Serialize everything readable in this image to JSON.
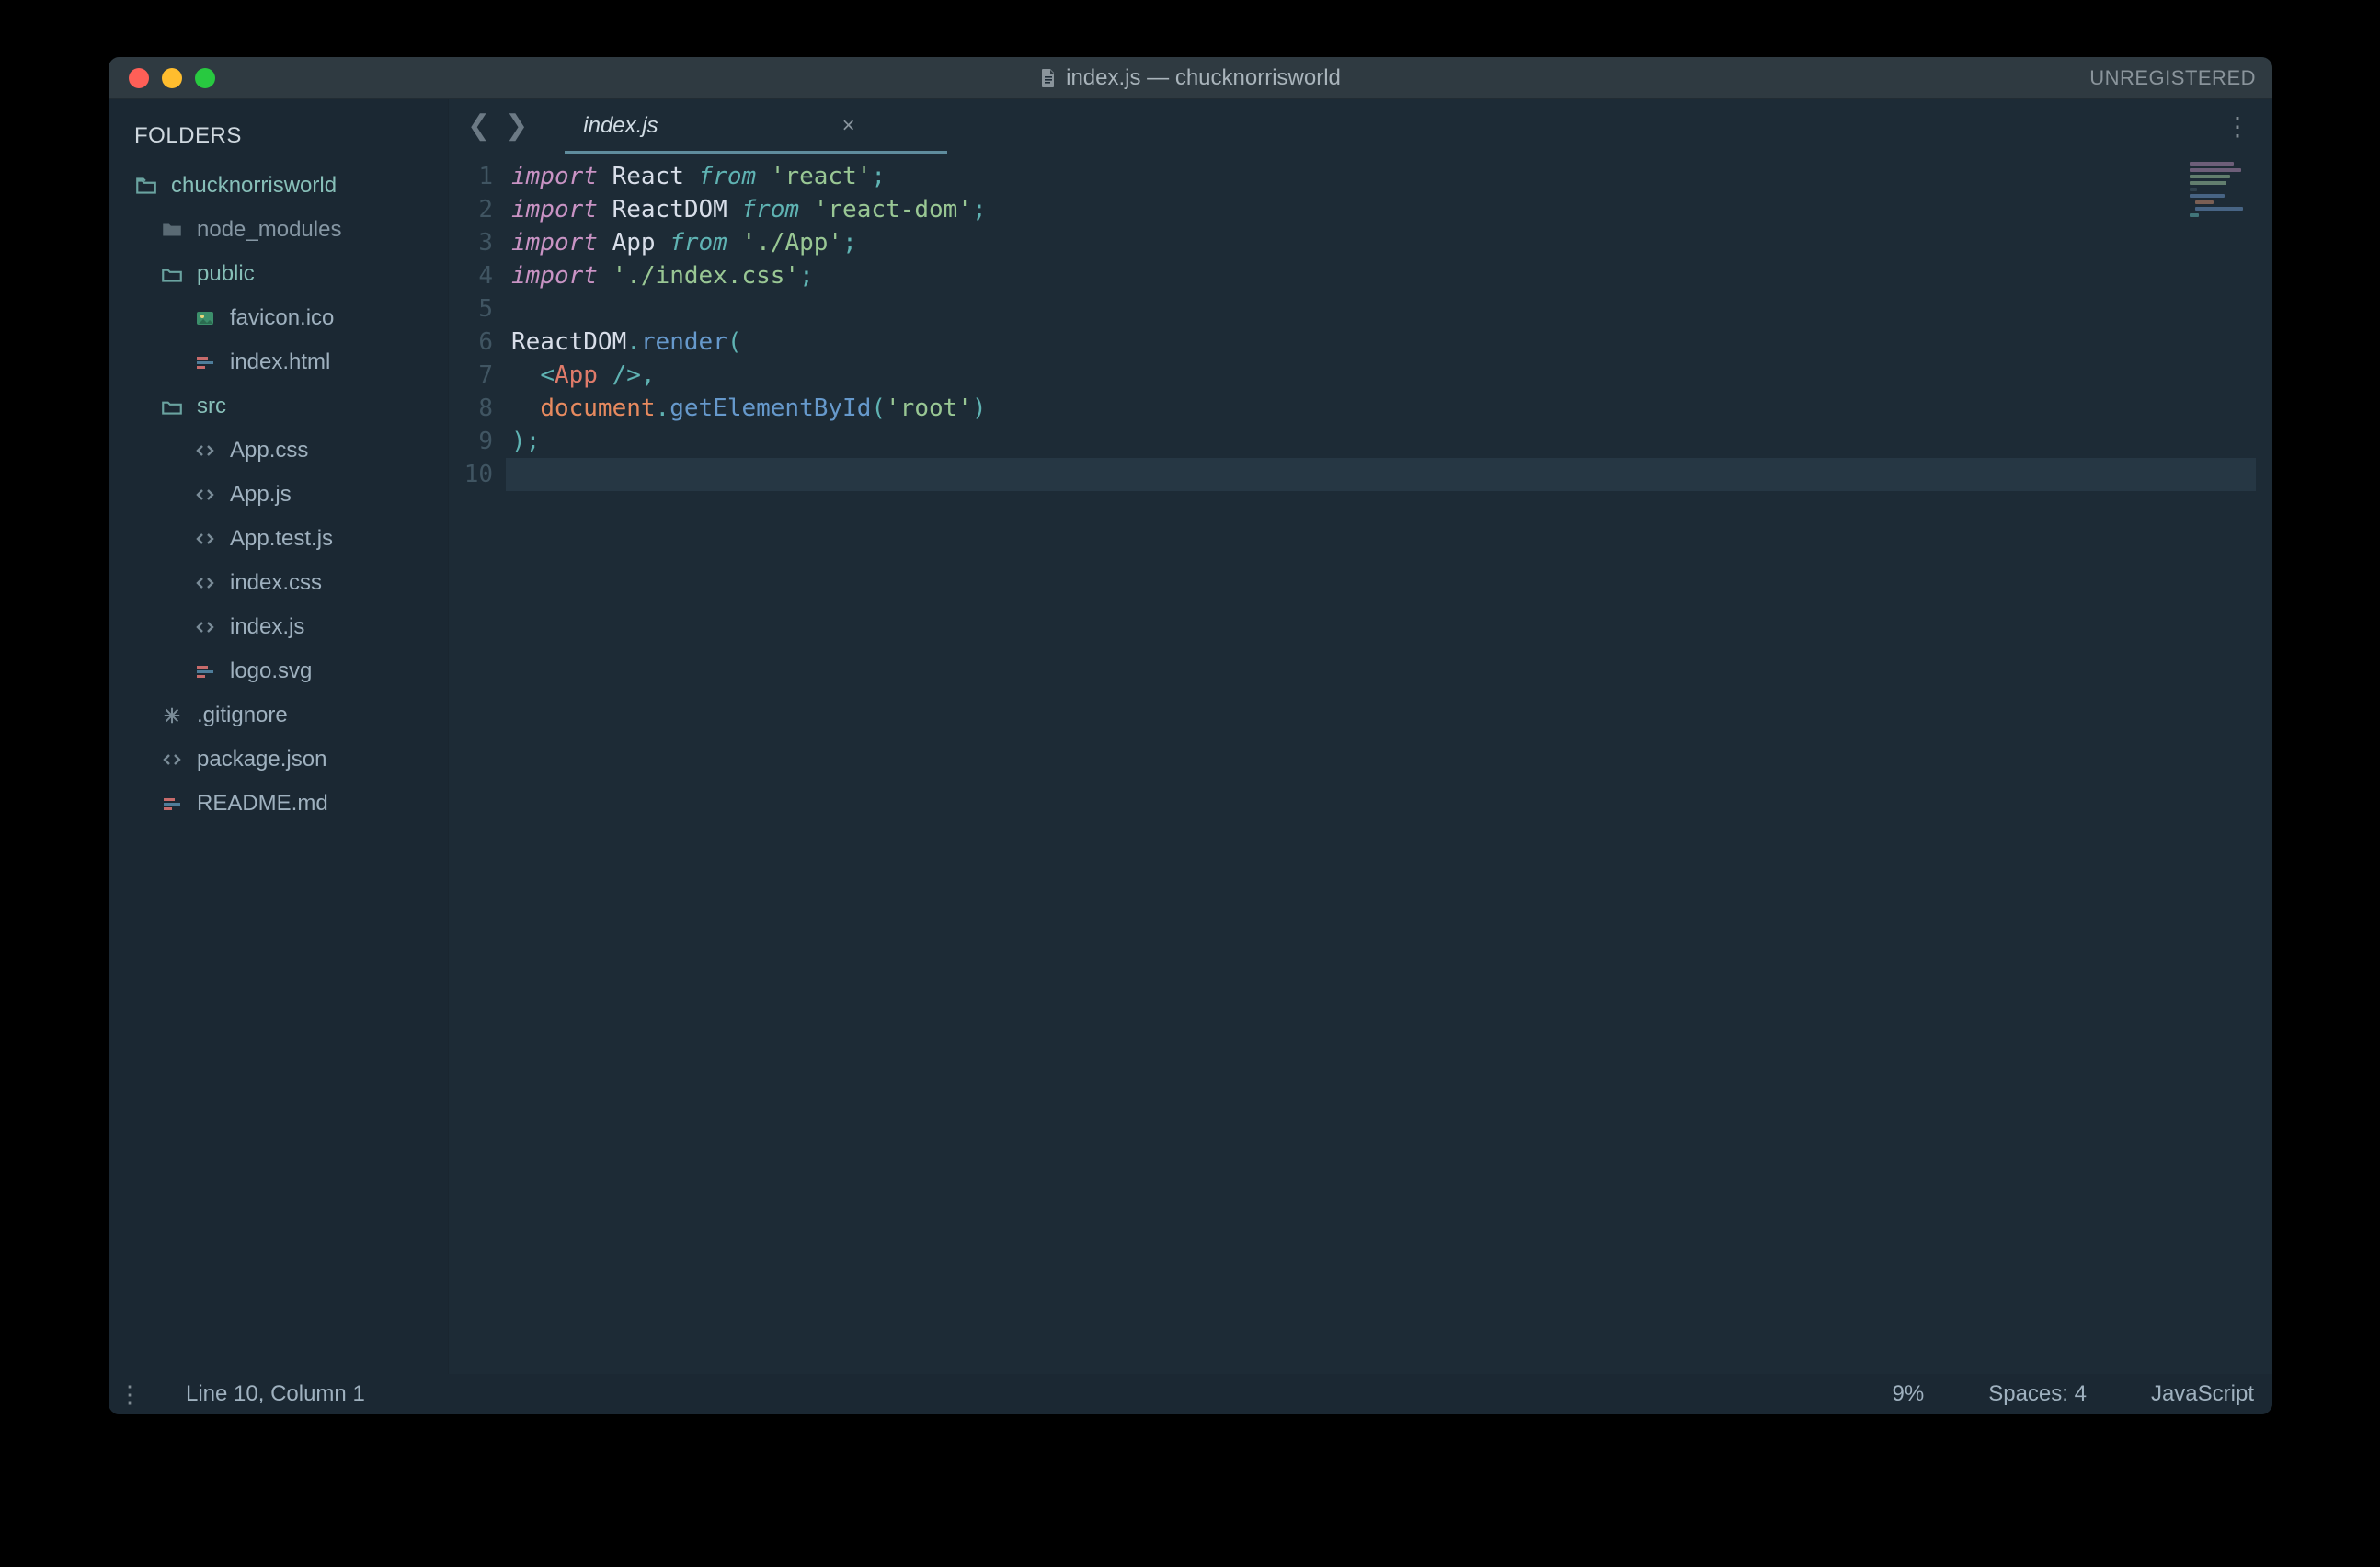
{
  "titlebar": {
    "title": "index.js — chucknorrisworld",
    "unregistered": "UNREGISTERED"
  },
  "sidebar": {
    "header": "FOLDERS",
    "tree": {
      "root": "chucknorrisworld",
      "node_modules": "node_modules",
      "public": "public",
      "public_items": {
        "favicon": "favicon.ico",
        "indexhtml": "index.html"
      },
      "src": "src",
      "src_items": {
        "appcss": "App.css",
        "appjs": "App.js",
        "apptest": "App.test.js",
        "indexcss": "index.css",
        "indexjs": "index.js",
        "logosvg": "logo.svg"
      },
      "gitignore": ".gitignore",
      "packagejson": "package.json",
      "readme": "README.md"
    }
  },
  "tabs": {
    "active": "index.js"
  },
  "editor": {
    "line_numbers": [
      "1",
      "2",
      "3",
      "4",
      "5",
      "6",
      "7",
      "8",
      "9",
      "10"
    ],
    "lines": {
      "l1": {
        "kw": "import",
        "id": "React",
        "from": "from",
        "str": "'react'",
        "end": ";"
      },
      "l2": {
        "kw": "import",
        "id": "ReactDOM",
        "from": "from",
        "str": "'react-dom'",
        "end": ";"
      },
      "l3": {
        "kw": "import",
        "id": "App",
        "from": "from",
        "str": "'./App'",
        "end": ";"
      },
      "l4": {
        "kw": "import",
        "str": "'./index.css'",
        "end": ";"
      },
      "l5": "",
      "l6": {
        "obj": "ReactDOM",
        "dot": ".",
        "fn": "render",
        "open": "("
      },
      "l7": {
        "indent": "  ",
        "lt": "<",
        "tag": "App",
        "sl": " /",
        "gt": ">",
        "comma": ","
      },
      "l8": {
        "indent": "  ",
        "obj": "document",
        "dot": ".",
        "fn": "getElementById",
        "open": "(",
        "str": "'root'",
        "close": ")"
      },
      "l9": {
        "close": ")",
        "semi": ";"
      },
      "l10": ""
    },
    "highlight_line_index": 9
  },
  "statusbar": {
    "position": "Line 10, Column 1",
    "percent": "9%",
    "spaces": "Spaces: 4",
    "language": "JavaScript"
  }
}
